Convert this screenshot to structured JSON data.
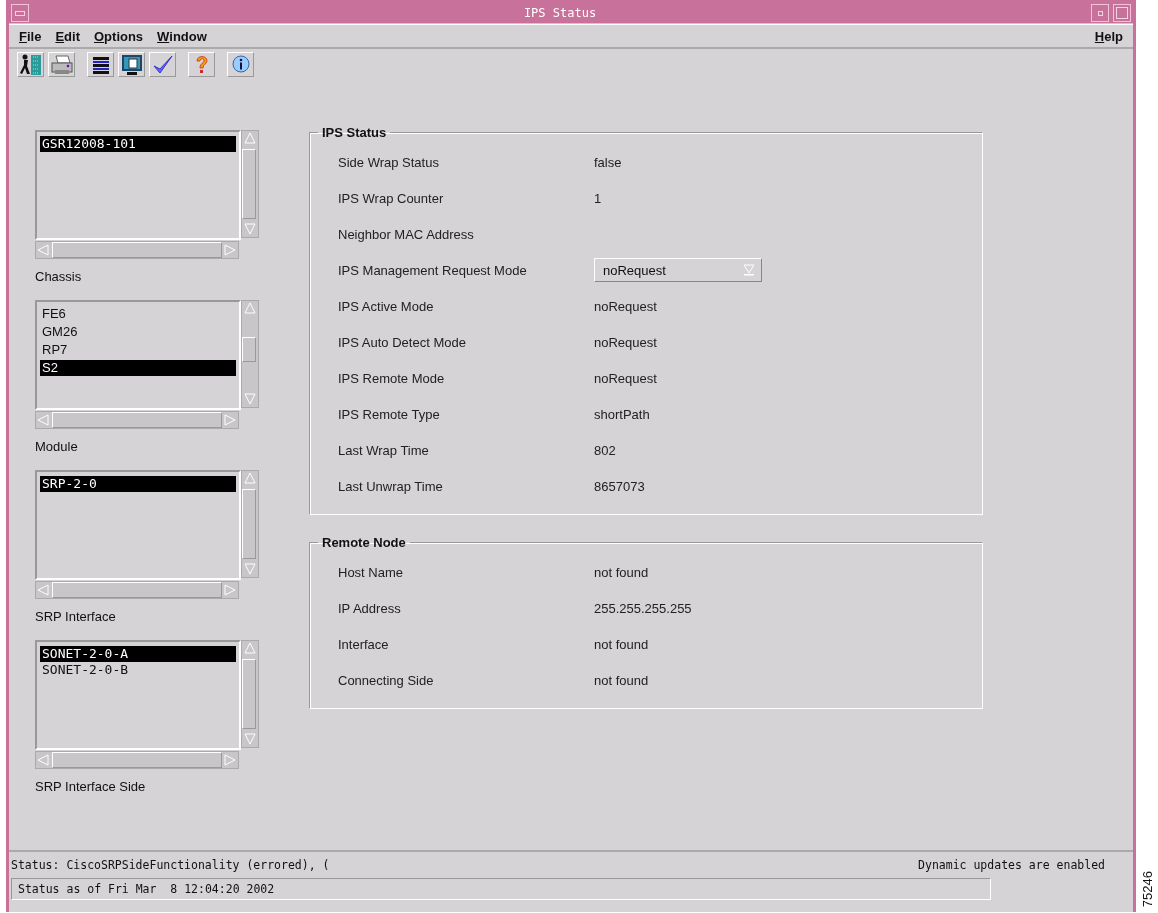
{
  "window": {
    "title": "IPS Status"
  },
  "menu": {
    "left": [
      {
        "label": "File"
      },
      {
        "label": "Edit"
      },
      {
        "label": "Options"
      },
      {
        "label": "Window"
      }
    ],
    "right": [
      {
        "label": "Help"
      }
    ]
  },
  "toolbar": [
    {
      "kind": "exit"
    },
    {
      "kind": "print"
    },
    {
      "kind": "list"
    },
    {
      "kind": "monitor"
    },
    {
      "kind": "check"
    },
    {
      "kind": "help"
    },
    {
      "kind": "info"
    }
  ],
  "selectors": [
    {
      "label": "Chassis",
      "items": [
        {
          "text": "GSR12008-101",
          "selected": true
        }
      ]
    },
    {
      "label": "Module",
      "items": [
        {
          "text": "FE6",
          "selected": false
        },
        {
          "text": "GM26",
          "selected": false
        },
        {
          "text": "RP7",
          "selected": false
        },
        {
          "text": "S2",
          "selected": true
        }
      ]
    },
    {
      "label": "SRP Interface",
      "items": [
        {
          "text": "SRP-2-0",
          "selected": true
        }
      ]
    },
    {
      "label": "SRP Interface Side",
      "items": [
        {
          "text": "SONET-2-0-A",
          "selected": true
        },
        {
          "text": "SONET-2-0-B",
          "selected": false
        }
      ]
    }
  ],
  "groups": [
    {
      "title": "IPS Status",
      "rows": [
        {
          "kind": "text",
          "label": "Side Wrap Status",
          "value": "false"
        },
        {
          "kind": "text",
          "label": "IPS Wrap Counter",
          "value": "1"
        },
        {
          "kind": "text",
          "label": "Neighbor MAC Address"
        },
        {
          "kind": "dropdown",
          "label": "IPS Management Request Mode",
          "value": "noRequest"
        },
        {
          "kind": "text",
          "label": "IPS Active Mode",
          "value": "noRequest"
        },
        {
          "kind": "text",
          "label": "IPS Auto Detect Mode",
          "value": "noRequest"
        },
        {
          "kind": "text",
          "label": "IPS Remote Mode",
          "value": "noRequest"
        },
        {
          "kind": "text",
          "label": "IPS Remote Type",
          "value": "shortPath"
        },
        {
          "kind": "text",
          "label": "Last Wrap Time",
          "value": "802"
        },
        {
          "kind": "text",
          "label": "Last Unwrap Time",
          "value": "8657073"
        }
      ]
    },
    {
      "title": "Remote Node",
      "rows": [
        {
          "kind": "text",
          "label": "Host Name",
          "value": "not found"
        },
        {
          "kind": "text",
          "label": "IP Address",
          "value": "255.255.255.255"
        },
        {
          "kind": "text",
          "label": "Interface",
          "value": "not found"
        },
        {
          "kind": "text",
          "label": "Connecting Side",
          "value": "not found"
        }
      ]
    }
  ],
  "status_bar": {
    "message": "Status: CiscoSRPSideFunctionality (errored), (",
    "updates": "Dynamic updates are enabled",
    "timestamp": "Status as of Fri Mar  8 12:04:20 2002"
  },
  "figure_number": "75246"
}
